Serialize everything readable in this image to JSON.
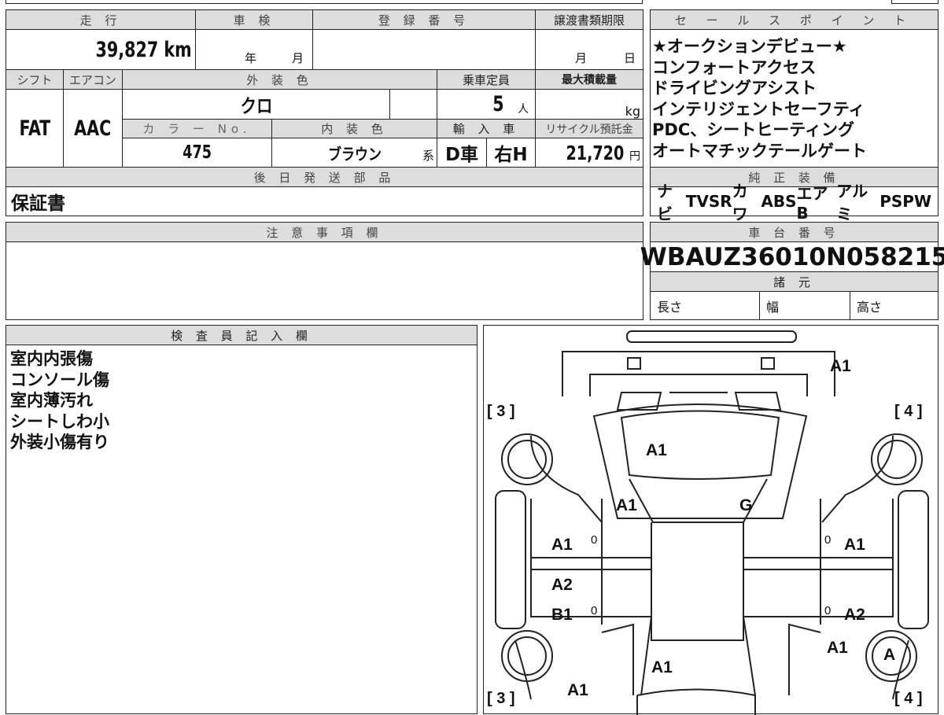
{
  "main": {
    "mileage_label": "走 行",
    "mileage": "39,827 km",
    "inspection_label": "車 検",
    "inspection_year": "年",
    "inspection_month": "月",
    "reg_label": "登 録 番 号",
    "transfer_label": "譲渡書類期限",
    "transfer_month": "月",
    "transfer_day": "日",
    "shift_label": "シフト",
    "ac_label": "エアコン",
    "ext_color_label": "外 装 色",
    "capacity_label": "乗車定員",
    "maxload_label": "最大積載量",
    "shift": "FAT",
    "ac": "AAC",
    "ext_color": "クロ",
    "capacity": "5",
    "capacity_unit": "人",
    "maxload_unit": "kg",
    "color_no_label": "カ ラ ー No.",
    "int_color_label": "内 装 色",
    "import_label": "輸 入 車",
    "recycle_label": "リサイクル預託金",
    "color_no": "475",
    "int_color": "ブラウン",
    "int_suffix": "系",
    "import_type": "D車",
    "steering": "右H",
    "recycle": "21,720",
    "recycle_unit": "円",
    "later_parts_label": "後 日 発 送 部 品",
    "later_parts": "保証書"
  },
  "sales": {
    "label": "セ ー ル ス ポ イ ン ト",
    "points": [
      "★オークションデビュー★",
      "コンフォートアクセス",
      "ドライビングアシスト",
      "インテリジェントセーフティ",
      "PDC、シートヒーティング",
      "オートマチックテールゲート"
    ]
  },
  "equipment": {
    "label": "純 正 装 備",
    "items": [
      "ナビ",
      "TV",
      "SR",
      "カワ",
      "ABS",
      "エアB",
      "アルミ",
      "PS",
      "PW"
    ]
  },
  "notes": {
    "label": "注 意 事 項 欄"
  },
  "chassis": {
    "label": "車 台 番 号",
    "vin": "WBAUZ36010N058215",
    "spec_label": "諸 元",
    "length": "長さ",
    "width": "幅",
    "height": "高さ"
  },
  "inspector": {
    "label": "検 査 員 記 入 欄",
    "notes": [
      "室内内張傷",
      "コンソール傷",
      "室内薄汚れ",
      "シートしわ小",
      "外装小傷有り"
    ]
  },
  "diagram": {
    "marks": [
      "A1",
      "A1",
      "A1",
      "G",
      "A1",
      "A1",
      "A2",
      "B1",
      "A2",
      "A1",
      "A",
      "A1",
      "A1"
    ],
    "tire_labels": [
      "[ 3 ]",
      "[ 4 ]",
      "[ 3 ]",
      "[ 4 ]"
    ],
    "zeros": [
      "0",
      "0",
      "0",
      "0"
    ]
  }
}
